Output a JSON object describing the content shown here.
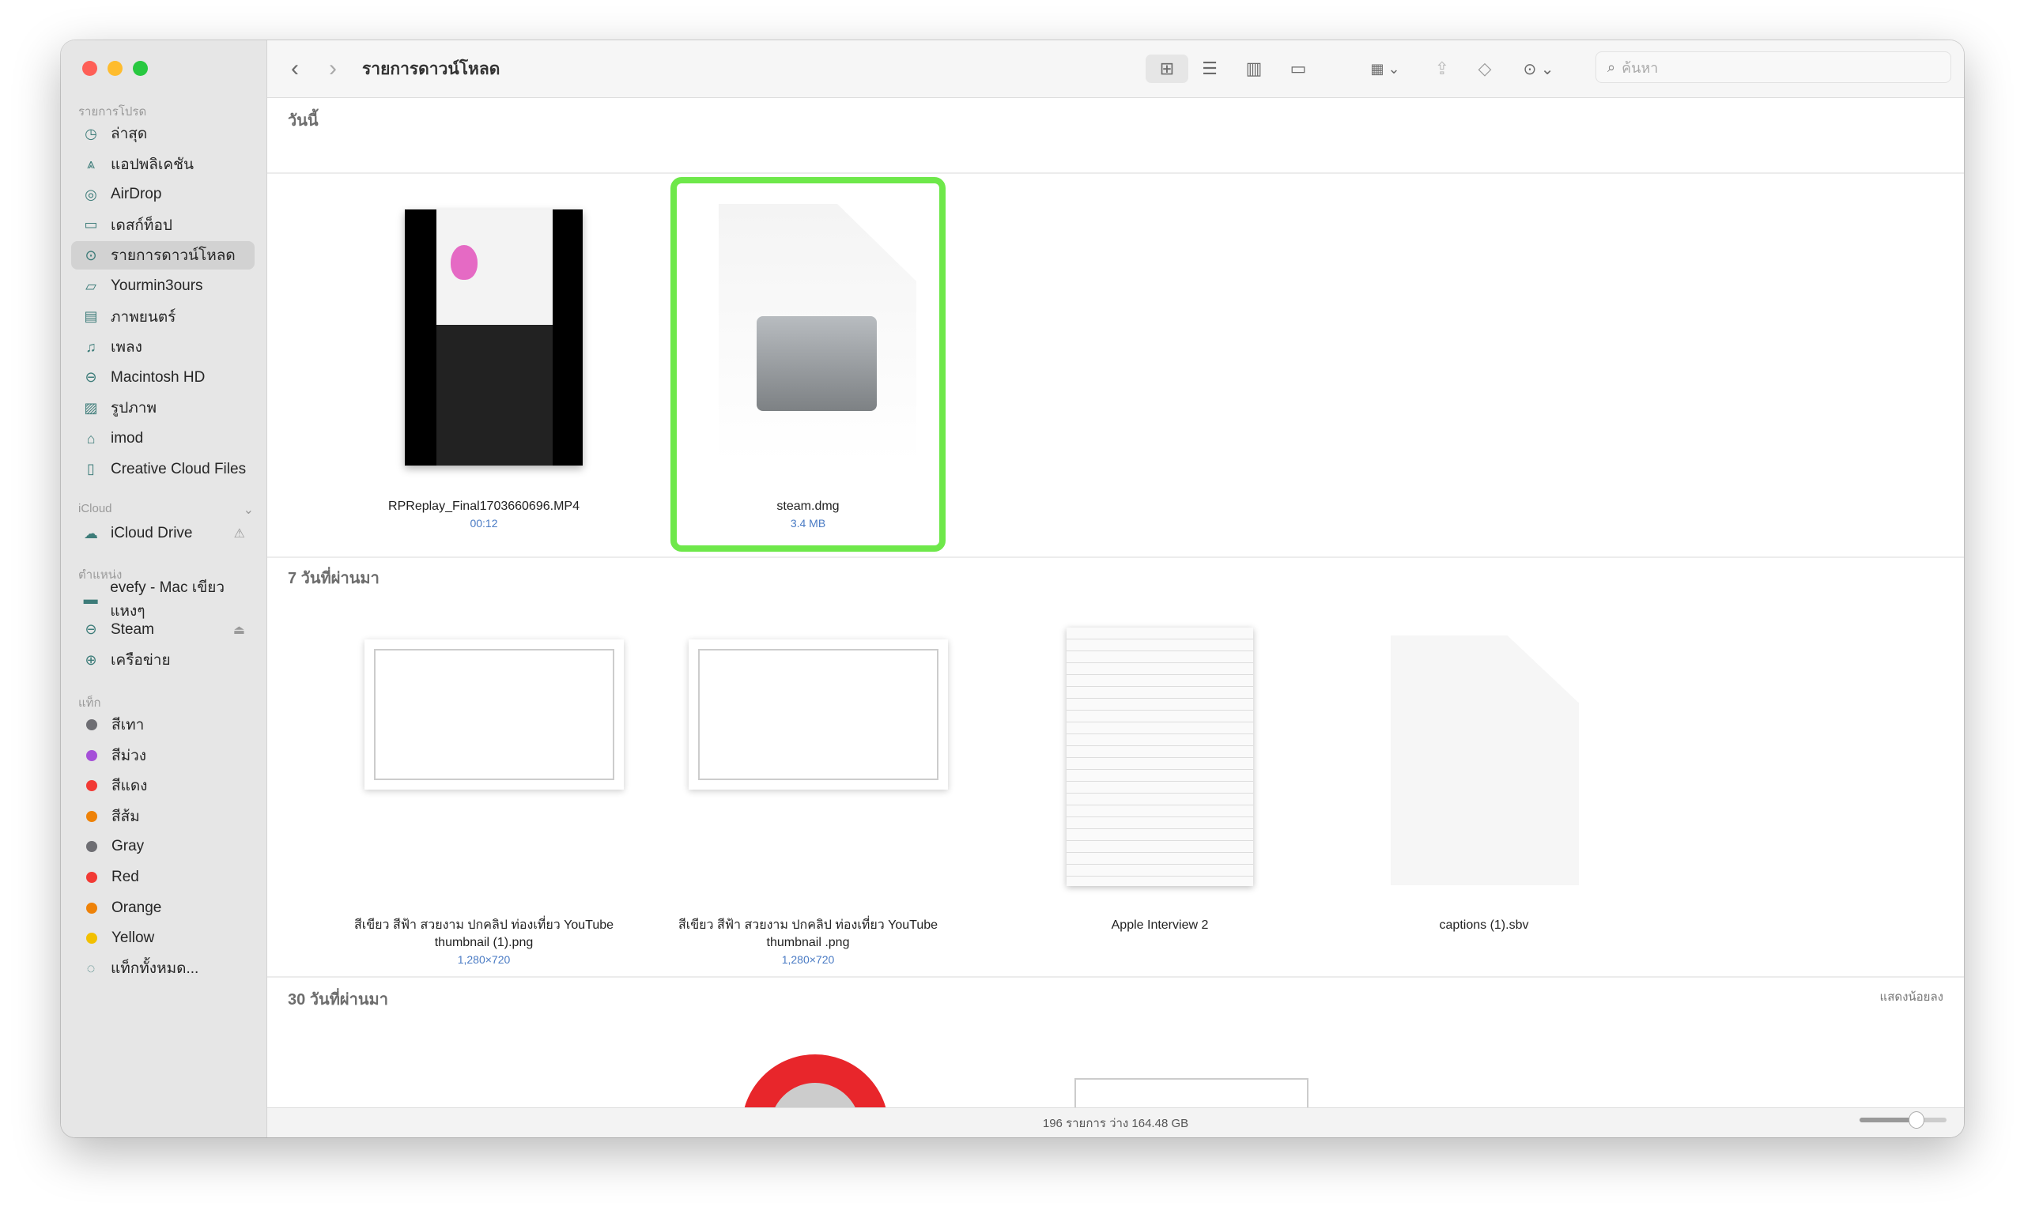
{
  "window": {
    "title": "รายการดาวน์โหลด"
  },
  "sidebar": {
    "favorites_header": "รายการโปรด",
    "favorites": [
      {
        "label": "ล่าสุด",
        "icon": "clock-icon"
      },
      {
        "label": "แอปพลิเคชัน",
        "icon": "apps-icon"
      },
      {
        "label": "AirDrop",
        "icon": "airdrop-icon"
      },
      {
        "label": "เดสก์ท็อป",
        "icon": "desktop-icon"
      },
      {
        "label": "รายการดาวน์โหลด",
        "icon": "download-icon",
        "selected": true
      },
      {
        "label": "Yourmin3ours",
        "icon": "folder-icon"
      },
      {
        "label": "ภาพยนตร์",
        "icon": "film-icon"
      },
      {
        "label": "เพลง",
        "icon": "music-icon"
      },
      {
        "label": "Macintosh HD",
        "icon": "disk-icon"
      },
      {
        "label": "รูปภาพ",
        "icon": "photo-icon"
      },
      {
        "label": "imod",
        "icon": "home-icon"
      },
      {
        "label": "Creative Cloud Files",
        "icon": "document-icon"
      }
    ],
    "icloud_header": "iCloud",
    "icloud": [
      {
        "label": "iCloud Drive",
        "icon": "cloud-icon"
      }
    ],
    "locations_header": "ตำแหน่ง",
    "locations": [
      {
        "label": "evefy - Mac เขียวแหงๆ",
        "icon": "computer-icon"
      },
      {
        "label": "Steam",
        "icon": "disk-icon"
      },
      {
        "label": "เครือข่าย",
        "icon": "network-icon"
      }
    ],
    "tags_header": "แท็ก",
    "tags": [
      {
        "label": "สีเทา",
        "color": "#6e6e73"
      },
      {
        "label": "สีม่วง",
        "color": "#a550d8"
      },
      {
        "label": "สีแดง",
        "color": "#f23a35"
      },
      {
        "label": "สีส้ม",
        "color": "#ee8208"
      },
      {
        "label": "Gray",
        "color": "#6e6e73"
      },
      {
        "label": "Red",
        "color": "#f23a35"
      },
      {
        "label": "Orange",
        "color": "#ee8208"
      },
      {
        "label": "Yellow",
        "color": "#f2c000"
      }
    ],
    "all_tags": "แท็กทั้งหมด..."
  },
  "toolbar": {
    "search_placeholder": "ค้นหา"
  },
  "sections": [
    {
      "title": "วันนี้",
      "items": [
        {
          "name": "RPReplay_Final1703660696.MP4",
          "meta": "00:12"
        },
        {
          "name": "steam.dmg",
          "meta": "3.4 MB",
          "highlighted": true
        }
      ]
    },
    {
      "title": "7 วันที่ผ่านมา",
      "items": [
        {
          "name": "สีเขียว สีฟ้า สวยงาม ปกคลิป ท่องเที่ยว YouTube thumbnail  (1).png",
          "meta": "1,280×720"
        },
        {
          "name": "สีเขียว สีฟ้า สวยงาม ปกคลิป ท่องเที่ยว YouTube thumbnail .png",
          "meta": "1,280×720"
        },
        {
          "name": "Apple Interview 2",
          "meta": ""
        },
        {
          "name": "captions (1).sbv",
          "meta": ""
        }
      ]
    },
    {
      "title": "30 วันที่ผ่านมา",
      "show_less": "แสดงน้อยลง"
    }
  ],
  "status": {
    "text": "196 รายการ ว่าง 164.48 GB",
    "icon_size": 0.35
  },
  "colors": {
    "highlight": "#6ee84a",
    "accent": "#3d7c79"
  }
}
